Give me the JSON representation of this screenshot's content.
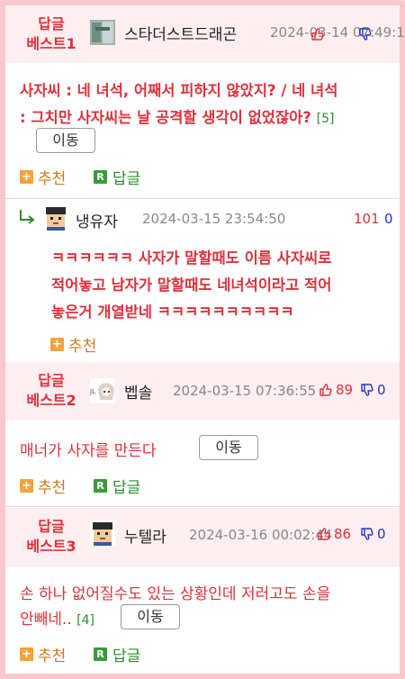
{
  "comments": [
    {
      "badge": [
        "답글",
        "베스트1"
      ],
      "nickname": "스타더스트드래곤",
      "date": "2024-03-14 07:49:1",
      "text_lines": [
        "사자씨 : 네 녀석, 어째서 피하지 않았지? / 네 녀석",
        ": 그치만 사자씨는 날 공격할 생각이 없었잖아?"
      ],
      "reply_count": "[5]",
      "move_label": "이동",
      "recommend_label": "추천",
      "reply_label": "답글"
    },
    {
      "nickname": "냉유자",
      "date": "2024-03-15 23:54:50",
      "up": "101",
      "down": "0",
      "text_lines": [
        "ㅋㅋㅋㅋㅋㅋ 사자가 말할때도 이름 사자씨로",
        "적어놓고 남자가 말할때도 네녀석이라고 적어",
        "놓은거 개열받네 ㅋㅋㅋㅋㅋㅋㅋㅋㅋㅋ"
      ],
      "recommend_label": "추천"
    },
    {
      "badge": [
        "답글",
        "베스트2"
      ],
      "nickname": "벱솔",
      "date": "2024-03-15 07:36:55",
      "up": "89",
      "down": "0",
      "text": "매너가 사자를 만든다",
      "move_label": "이동",
      "recommend_label": "추천",
      "reply_label": "답글"
    },
    {
      "badge": [
        "답글",
        "베스트3"
      ],
      "nickname": "누텔라",
      "date": "2024-03-16 00:02:44",
      "up": "86",
      "down": "0",
      "text_lines": [
        "손 하나 없어질수도 있는 상황인데 저러고도 손을",
        "안빼네.."
      ],
      "reply_count": "[4]",
      "move_label": "이동",
      "recommend_label": "추천",
      "reply_label": "답글"
    }
  ],
  "colors": {
    "accent_red": "#e0303b",
    "header_pink": "#fdeef0",
    "reply_green": "#2e8b2e",
    "down_blue": "#2233cc"
  }
}
